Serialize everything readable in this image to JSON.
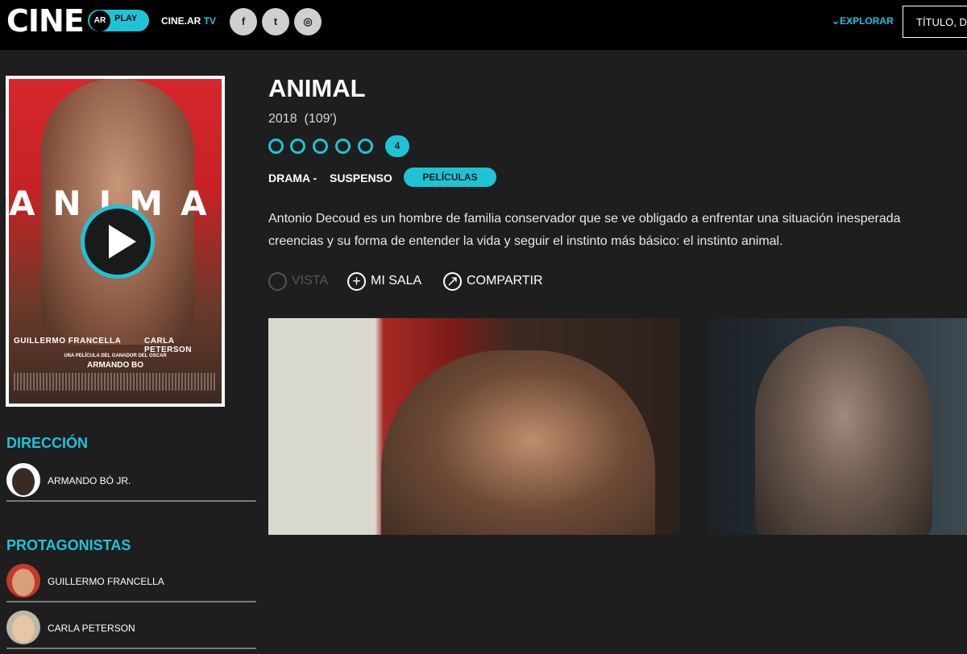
{
  "header": {
    "logo_text": "CINE",
    "logo_badge": "AR",
    "logo_play": "PLAY",
    "cinear": "CINE.AR",
    "tv": "TV",
    "social": [
      "f",
      "t",
      "◎"
    ],
    "explorar": "EXPLORAR",
    "search_text": "TÍTULO, D"
  },
  "poster": {
    "title": "ANIMAL",
    "actor_left": "GUILLERMO FRANCELLA",
    "actor_right": "CARLA PETERSON",
    "tagline": "UNA PELÍCULA DEL GANADOR DEL OSCAR",
    "director": "ARMANDO BO"
  },
  "sidebar": {
    "direccion_title": "DIRECCIÓN",
    "direccion": [
      {
        "name": "ARMANDO BÓ JR."
      }
    ],
    "protagonistas_title": "PROTAGONISTAS",
    "protagonistas": [
      {
        "name": "GUILLERMO FRANCELLA"
      },
      {
        "name": "CARLA PETERSON"
      }
    ]
  },
  "movie": {
    "title": "ANIMAL",
    "year": "2018",
    "duration": "(109')",
    "rating": "4",
    "genre1": "DRAMA -",
    "genre2": "SUSPENSO",
    "category": "PELÍCULAS",
    "synopsis_line1": "Antonio Decoud es un hombre de familia conservador que se ve obligado a enfrentar una situación inesperada",
    "synopsis_line2": "creencias y su forma de entender la vida y seguir el instinto más básico: el instinto animal."
  },
  "actions": {
    "vista": "VISTA",
    "mi_sala": "MI SALA",
    "compartir": "COMPARTIR"
  },
  "colors": {
    "accent": "#1fc3d6",
    "background": "#1e1e1e",
    "header": "#000000"
  }
}
